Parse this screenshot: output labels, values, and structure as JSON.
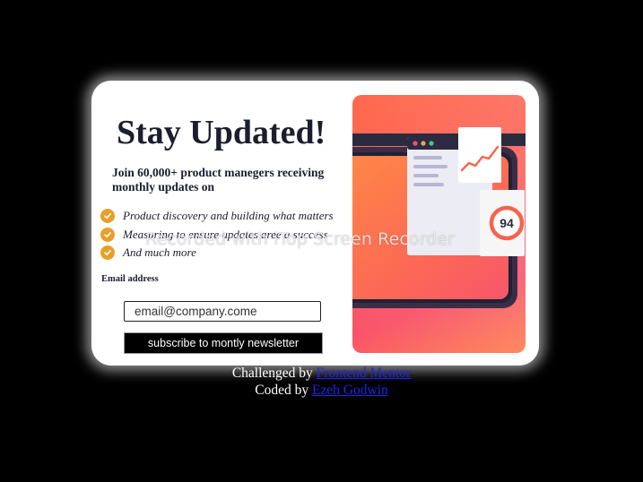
{
  "card": {
    "title": "Stay Updated!",
    "intro": "Join 60,000+ product manegers receiving monthly updates on",
    "features": [
      "Product discovery and building what matters",
      "Measuring to ensure updates aree a success",
      "And much more"
    ],
    "email_label": "Email address",
    "email_value": "email@company.come",
    "subscribe_label": "subscribe to montly newsletter"
  },
  "hero": {
    "score": "94"
  },
  "footer": {
    "challenged_prefix": "Challenged by ",
    "challenged_link": "Frontend Mentor",
    "coded_prefix": "Coded by ",
    "coded_link": "Ezeh Godwin"
  },
  "watermark": "Recorded with iTop Screen Recorder",
  "colors": {
    "accent": "#e8a02a",
    "gradient_start": "#ff6a4c",
    "gradient_end": "#f9536b",
    "link": "#2323ee"
  },
  "icons": [
    "check-icon"
  ]
}
